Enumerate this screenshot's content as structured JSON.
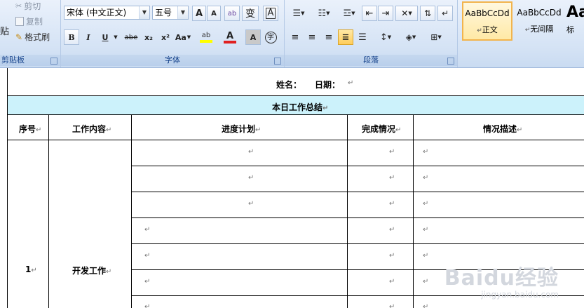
{
  "ribbon": {
    "clipboard": {
      "paste_partial": "贴",
      "cut": "剪切",
      "copy": "复制",
      "format_painter": "格式刷",
      "group_label": "剪贴板"
    },
    "font": {
      "font_name": "宋体 (中文正文)",
      "font_size": "五号",
      "grow_label": "A",
      "shrink_label": "A",
      "clear_label": "ab",
      "phonetic_label": "变",
      "border_char_label": "A",
      "bold_label": "B",
      "italic_label": "I",
      "underline_label": "U",
      "strike_label": "abe",
      "subscript_label": "x₂",
      "superscript_label": "x²",
      "case_label": "Aa",
      "highlight_label": "ab",
      "font_color_label": "A",
      "shade_label": "A",
      "enclose_label": "字",
      "group_label": "字体",
      "font_color": "#e02020",
      "highlight_color": "#ffff00"
    },
    "paragraph": {
      "group_label": "段落"
    },
    "styles": {
      "items": [
        {
          "sample": "AaBbCcDd",
          "name": "正文"
        },
        {
          "sample": "AaBbCcDd",
          "name": "无间隔"
        },
        {
          "sample": "Aa",
          "name": "标"
        }
      ],
      "mark": "↵"
    }
  },
  "document": {
    "name_label": "姓名：",
    "date_label": "日期：",
    "summary_title": "本日工作总结",
    "headers": [
      "序号",
      "工作内容",
      "进度计划",
      "完成情况",
      "情况描述"
    ],
    "row_number": "1",
    "work_content": "开发工作",
    "mark": "↵",
    "summary_bg": "#ccf2fb"
  },
  "watermark": {
    "main": "Baidu经验",
    "sub": "jingyan.baidu.com"
  }
}
